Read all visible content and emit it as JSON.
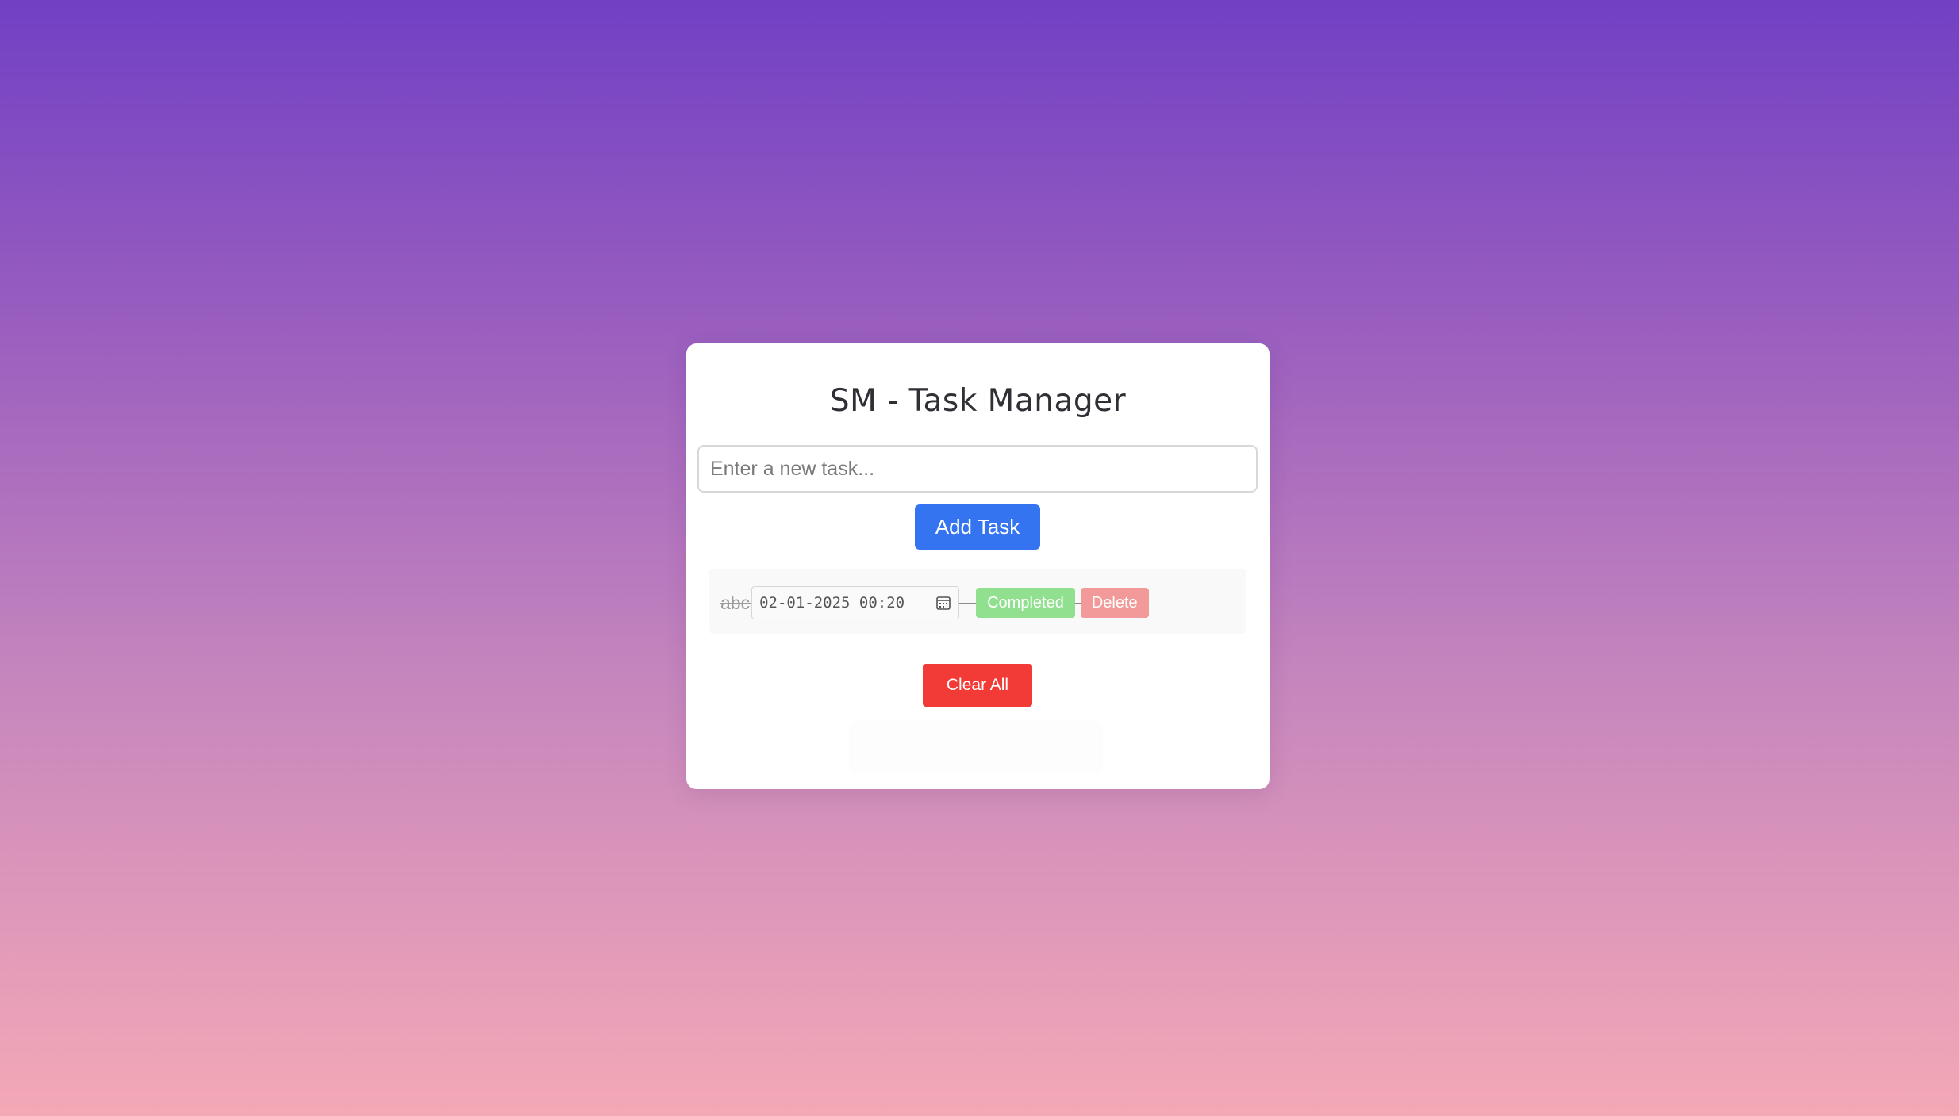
{
  "app": {
    "title": "SM - Task Manager"
  },
  "task_input": {
    "value": "",
    "placeholder": "Enter a new task..."
  },
  "buttons": {
    "add_task": "Add Task",
    "clear_all": "Clear All"
  },
  "tasks": [
    {
      "text": "abc",
      "completed": true,
      "due": "02-01-2025  00:20",
      "complete_label": "Completed",
      "delete_label": "Delete",
      "icons": {
        "date_picker": "calendar-icon"
      }
    }
  ],
  "colors": {
    "gradient_top": "#7140c4",
    "gradient_bottom": "#f4a8b6",
    "add_button": "#3574f0",
    "completed_button": "#90e08f",
    "delete_button": "#f29a9a",
    "clear_button": "#f23a36"
  }
}
